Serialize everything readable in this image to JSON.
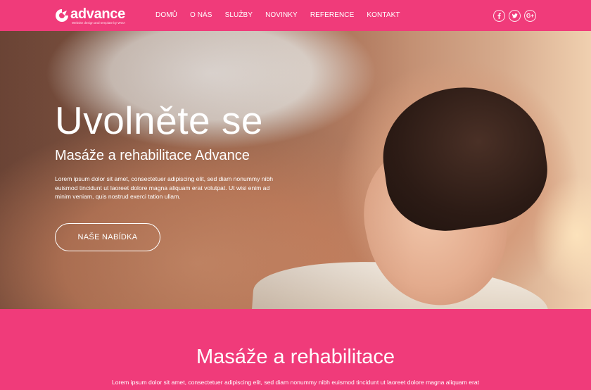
{
  "brand": {
    "name": "advance",
    "tagline": "Website design and template by WOA"
  },
  "nav": {
    "items": [
      {
        "label": "DOMŮ"
      },
      {
        "label": "O NÁS"
      },
      {
        "label": "SLUŽBY"
      },
      {
        "label": "NOVINKY"
      },
      {
        "label": "REFERENCE"
      },
      {
        "label": "KONTAKT"
      }
    ]
  },
  "social": {
    "icons": [
      "facebook-icon",
      "twitter-icon",
      "google-plus-icon"
    ],
    "googleplus_label": "G+"
  },
  "hero": {
    "title": "Uvolněte se",
    "subtitle": "Masáže a rehabilitace Advance",
    "text": "Lorem ipsum dolor sit amet, consectetuer adipiscing elit, sed diam nonummy nibh euismod tincidunt ut laoreet dolore magna aliquam erat volutpat. Ut wisi enim ad minim veniam, quis nostrud exerci tation ullam.",
    "button_label": "NAŠE NABÍDKA"
  },
  "section": {
    "title": "Masáže a rehabilitace",
    "text": "Lorem ipsum dolor sit amet, consectetuer adipiscing elit, sed diam nonummy nibh euismod tincidunt ut laoreet dolore magna aliquam erat"
  },
  "colors": {
    "brand_pink": "#f03b7a",
    "white": "#ffffff"
  }
}
